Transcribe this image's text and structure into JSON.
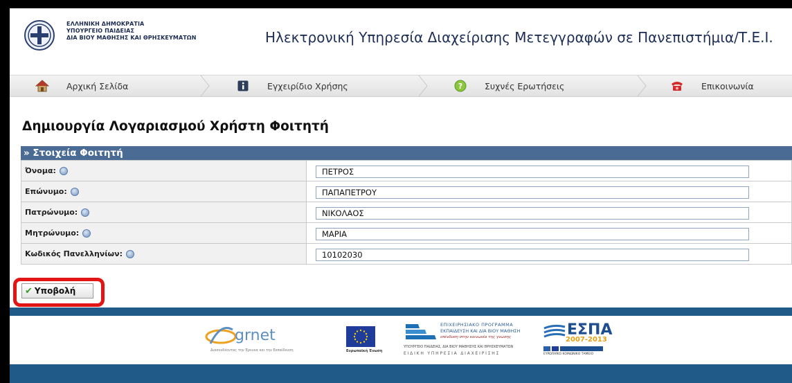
{
  "header": {
    "ministry_line1": "ΕΛΛΗΝΙΚΗ ΔΗΜΟΚΡΑΤΙΑ",
    "ministry_line2": "ΥΠΟΥΡΓΕΙΟ ΠΑΙΔΕΙΑΣ",
    "ministry_line3": "ΔΙΑ ΒΙΟΥ ΜΑΘΗΣΗΣ ΚΑΙ ΘΡΗΣΚΕΥΜΑΤΩΝ",
    "site_title": "Ηλεκτρονική Υπηρεσία Διαχείρισης Μετεγγραφών σε Πανεπιστήμια/Τ.Ε.Ι."
  },
  "nav": {
    "items": [
      {
        "label": "Αρχική Σελίδα",
        "icon": "home-icon"
      },
      {
        "label": "Εγχειρίδιο Χρήσης",
        "icon": "info-icon"
      },
      {
        "label": "Συχνές Ερωτήσεις",
        "icon": "help-icon"
      },
      {
        "label": "Επικοινωνία",
        "icon": "phone-icon"
      }
    ]
  },
  "form": {
    "title": "Δημιουργία Λογαριασμού Χρήστη Φοιτητή",
    "section_title": "» Στοιχεία Φοιτητή",
    "fields": [
      {
        "label": "Όνομα:",
        "value": "ΠΕΤΡΟΣ"
      },
      {
        "label": "Επώνυμο:",
        "value": "ΠΑΠΑΠΕΤΡΟΥ"
      },
      {
        "label": "Πατρώνυμο:",
        "value": "ΝΙΚΟΛΑΟΣ"
      },
      {
        "label": "Μητρώνυμο:",
        "value": "ΜΑΡΙΑ"
      },
      {
        "label": "Κωδικός Πανελληνίων:",
        "value": "10102030"
      }
    ],
    "submit_label": "Υποβολή"
  },
  "footer": {
    "grnet_name": "grnet",
    "grnet_tagline": "Διασυνδέοντας την Έρευνα και την Εκπαίδευση",
    "eu_caption": "Ευρωπαϊκή Ένωση",
    "program_line1": "ΕΠΙΧΕΙΡΗΣΙΑΚΟ ΠΡΟΓΡΑΜΜΑ",
    "program_line2": "ΕΚΠΑΙΔΕΥΣΗ ΚΑΙ ΔΙΑ ΒΙΟΥ ΜΑΘΗΣΗ",
    "program_line3": "επένδυση στην κοινωνία της γνώσης",
    "program_line4": "ΥΠΟΥΡΓΕΙΟ ΠΑΙΔΕΙΑΣ, ΔΙΑ ΒΙΟΥ ΜΑΘΗΣΗΣ ΚΑΙ ΘΡΗΣΚΕΥΜΑΤΩΝ",
    "program_line5": "ΕΙΔΙΚΗ ΥΠΗΡΕΣΙΑ ΔΙΑΧΕΙΡΙΣΗΣ",
    "espa_name": "ΕΣΠΑ",
    "espa_years": "2007-2013",
    "espa_caption": "ΕΥΡΩΠΑΪΚΟ ΚΟΙΝΩΝΙΚΟ ΤΑΜΕΙΟ"
  },
  "colors": {
    "section_bar": "#4a6b94",
    "footer_bar": "#1f5a88",
    "highlight": "#e31414"
  }
}
